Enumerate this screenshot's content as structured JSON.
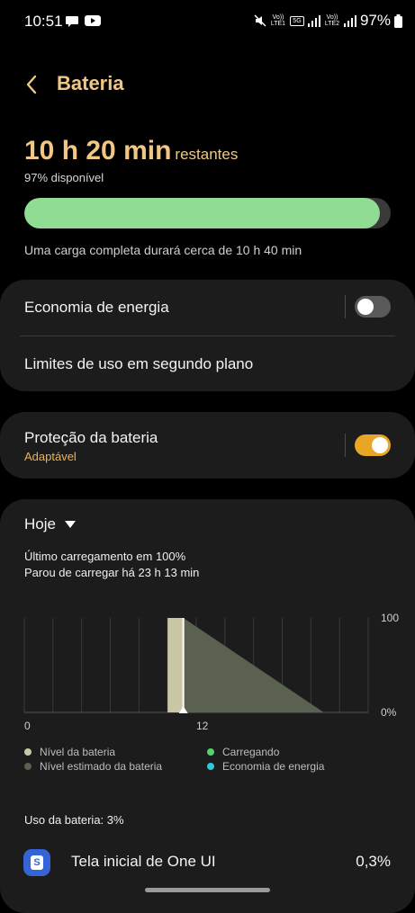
{
  "status": {
    "time": "10:51",
    "volte1": "Vo)) LTE1",
    "network_5g": "5G",
    "volte2": "Vo)) LTE2",
    "battery_percent": "97%"
  },
  "header": {
    "title": "Bateria"
  },
  "summary": {
    "time_value": "10 h 20 min",
    "time_suffix": "restantes",
    "available": "97% disponível",
    "battery_level_pct": 97,
    "full_charge_note": "Uma carga completa durará cerca de 10 h 40 min"
  },
  "settings": {
    "power_saving_label": "Economia de energia",
    "power_saving_on": false,
    "background_limits_label": "Limites de uso em segundo plano",
    "protection_label": "Proteção da bateria",
    "protection_sub": "Adaptável",
    "protection_on": true
  },
  "usage": {
    "period": "Hoje",
    "last_charge": "Último carregamento em 100%",
    "stopped": "Parou de carregar há 23 h 13 min",
    "chart": {
      "y_top_label": "100",
      "y_bottom_label": "0%",
      "x_labels": [
        "0",
        "12"
      ]
    },
    "legend": [
      {
        "label": "Nível da bateria",
        "color": "#c9c7a6"
      },
      {
        "label": "Carregando",
        "color": "#57d26b"
      },
      {
        "label": "Nível estimado da bateria",
        "color": "#5b6150"
      },
      {
        "label": "Economia de energia",
        "color": "#2fc8d8"
      }
    ],
    "usage_total": "Uso da bateria: 3%",
    "apps": [
      {
        "name": "Tela inicial de One UI",
        "percent": "0,3%"
      }
    ]
  },
  "chart_data": {
    "type": "area",
    "y_range": [
      0,
      100
    ],
    "x_tick_labels": [
      "0",
      "12"
    ],
    "series": [
      {
        "name": "Nível da bateria",
        "points": [
          [
            10,
            100
          ],
          [
            11.1,
            100
          ]
        ]
      },
      {
        "name": "Nível estimado da bateria",
        "points": [
          [
            11.1,
            100
          ],
          [
            20.9,
            0
          ]
        ]
      }
    ]
  },
  "colors": {
    "accent": "#f2c784",
    "battery_bar": "#8fdc92",
    "toggle_on": "#e9a526",
    "card_bg": "#1c1c1c"
  }
}
